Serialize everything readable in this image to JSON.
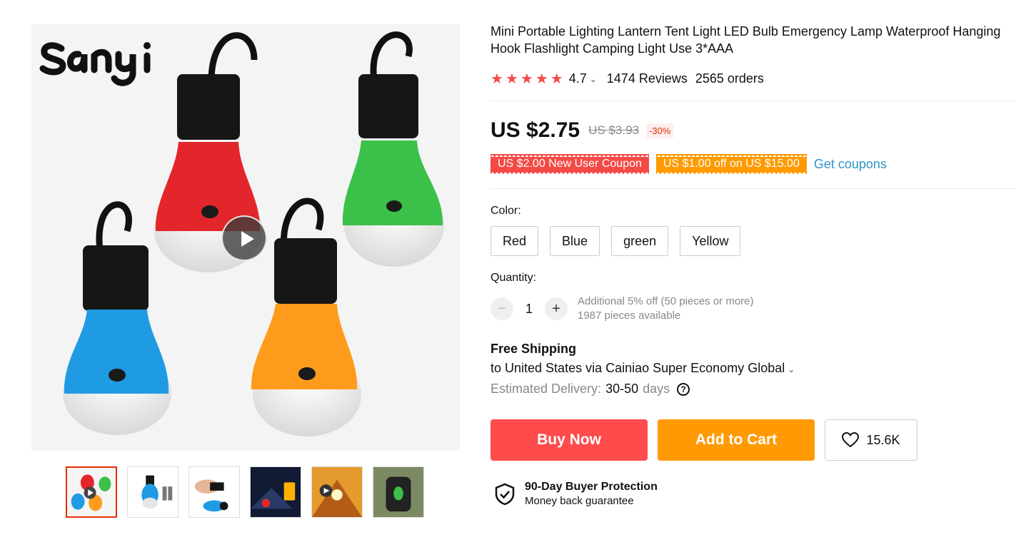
{
  "brand_logo_text": "Sanyi",
  "gallery": {
    "thumbnails": [
      {
        "name": "lanterns-four-colors"
      },
      {
        "name": "blue-lantern-with-batteries"
      },
      {
        "name": "lantern-in-hand"
      },
      {
        "name": "lantern-night-tent"
      },
      {
        "name": "lantern-in-tent"
      },
      {
        "name": "lantern-on-backpack"
      }
    ]
  },
  "product": {
    "title": "Mini Portable Lighting Lantern Tent Light LED Bulb Emergency Lamp Waterproof Hanging Hook Flashlight Camping Light Use 3*AAA",
    "rating": "4.7",
    "stars": 5,
    "reviews": "1474 Reviews",
    "orders": "2565 orders",
    "price": "US $2.75",
    "original_price": "US $3.93",
    "discount": "-30%"
  },
  "coupons": {
    "items": [
      "US $2.00 New User Coupon",
      "US $1.00 off on US $15.00"
    ],
    "get_label": "Get coupons"
  },
  "color": {
    "label": "Color:",
    "options": [
      "Red",
      "Blue",
      "green",
      "Yellow"
    ]
  },
  "quantity": {
    "label": "Quantity:",
    "value": "1",
    "minus": "−",
    "plus": "+",
    "note1": "Additional 5% off (50 pieces or more)",
    "note2": "1987 pieces available"
  },
  "shipping": {
    "title": "Free Shipping",
    "route": "to United States via Cainiao Super Economy Global",
    "estimated_label": "Estimated Delivery:",
    "days_value": "30-50",
    "days_unit": "days"
  },
  "actions": {
    "buy_now": "Buy Now",
    "add_to_cart": "Add to Cart",
    "wishlist_count": "15.6K"
  },
  "protection": {
    "title": "90-Day Buyer Protection",
    "subtitle": "Money back guarantee"
  },
  "colors": {
    "accent_red": "#ff4b4b",
    "accent_orange": "#ff9a02",
    "link_blue": "#2e93c8",
    "star_red": "#f44a46"
  }
}
